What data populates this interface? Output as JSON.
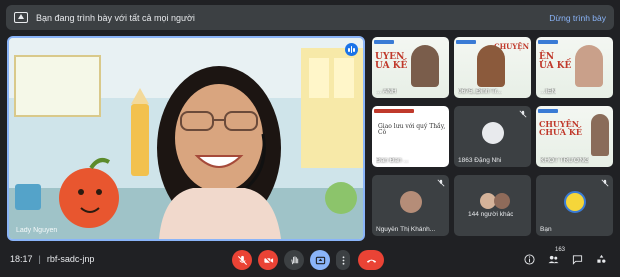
{
  "banner": {
    "message": "Bạn đang trình bày với tất cả mọi người",
    "stop_label": "Dừng trình bày"
  },
  "main_speaker": {
    "name": "Lady Nguyen"
  },
  "tiles": [
    {
      "name": "... ANH",
      "slide_title": "UYEN\nUA KẾ"
    },
    {
      "name": "0675_Đinh Tr...",
      "slide_title": "CHUYỆN"
    },
    {
      "name": "...IEN",
      "slide_title": "ỆN\nUA KẾ"
    },
    {
      "name": "Đan Đan ...",
      "slide_title": "Giao lưu với quý Thầy, Cô"
    },
    {
      "name": "1863 Đặng Nhi"
    },
    {
      "name": "KHÓT TRƯỜNG",
      "slide_title": "CHUYỆN\nCHƯA KẾ"
    },
    {
      "name": "Nguyễn Thị Khánh..."
    },
    {
      "name": "144 người khác"
    },
    {
      "name": "Bạn"
    }
  ],
  "bottom_bar": {
    "time": "18:17",
    "separator": "|",
    "meeting_code": "rbf-sadc-jnp",
    "participant_count": "163"
  },
  "colors": {
    "background": "#202124",
    "surface": "#3c4043",
    "accent": "#8ab4f8",
    "danger": "#ea4335",
    "present_active": "#8ab4f8"
  },
  "icons": [
    "present-icon",
    "mic-off-icon",
    "camera-off-icon",
    "raise-hand-icon",
    "present-screen-icon",
    "more-icon",
    "end-call-icon",
    "info-icon",
    "people-icon",
    "chat-icon",
    "activities-icon",
    "lock-icon",
    "speaking-icon",
    "mic-muted-icon"
  ]
}
